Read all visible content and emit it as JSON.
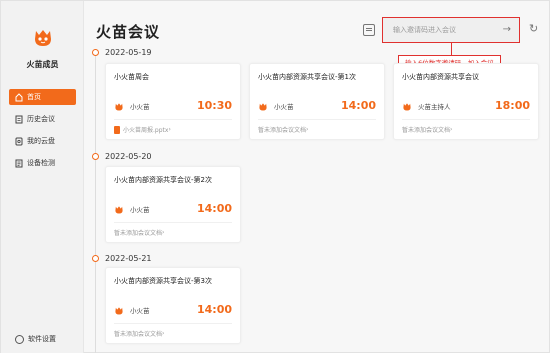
{
  "app": {
    "name": "火苗成员"
  },
  "sidebar": {
    "items": [
      {
        "label": "首页",
        "icon": "home-icon",
        "active": true
      },
      {
        "label": "历史会议",
        "icon": "history-icon",
        "active": false
      },
      {
        "label": "我的云盘",
        "icon": "cloud-drive-icon",
        "active": false
      },
      {
        "label": "设备检测",
        "icon": "device-check-icon",
        "active": false
      }
    ],
    "settings_label": "软件设置"
  },
  "header": {
    "title": "火苗会议",
    "join_placeholder": "输入邀请码进入会议",
    "tooltip": "输入6位数字邀请码，加入会议"
  },
  "colors": {
    "accent": "#f26a1b",
    "highlight": "#e0312f"
  },
  "groups": [
    {
      "date": "2022-05-19",
      "meetings": [
        {
          "title": "小火苗周会",
          "host": "小火苗",
          "time": "10:30",
          "doc": "小火苗周报.pptx",
          "has_doc": true
        },
        {
          "title": "小火苗内部资源共享会议-第1次",
          "host": "小火苗",
          "time": "14:00",
          "doc": "暂未添加会议文档",
          "has_doc": false
        },
        {
          "title": "小火苗内部资源共享会议",
          "host": "火苗主持人",
          "time": "18:00",
          "doc": "暂未添加会议文档",
          "has_doc": false
        }
      ]
    },
    {
      "date": "2022-05-20",
      "meetings": [
        {
          "title": "小火苗内部资源共享会议-第2次",
          "host": "小火苗",
          "time": "14:00",
          "doc": "暂未添加会议文档",
          "has_doc": false
        }
      ]
    },
    {
      "date": "2022-05-21",
      "meetings": [
        {
          "title": "小火苗内部资源共享会议-第3次",
          "host": "小火苗",
          "time": "14:00",
          "doc": "暂未添加会议文档",
          "has_doc": false
        }
      ]
    }
  ]
}
